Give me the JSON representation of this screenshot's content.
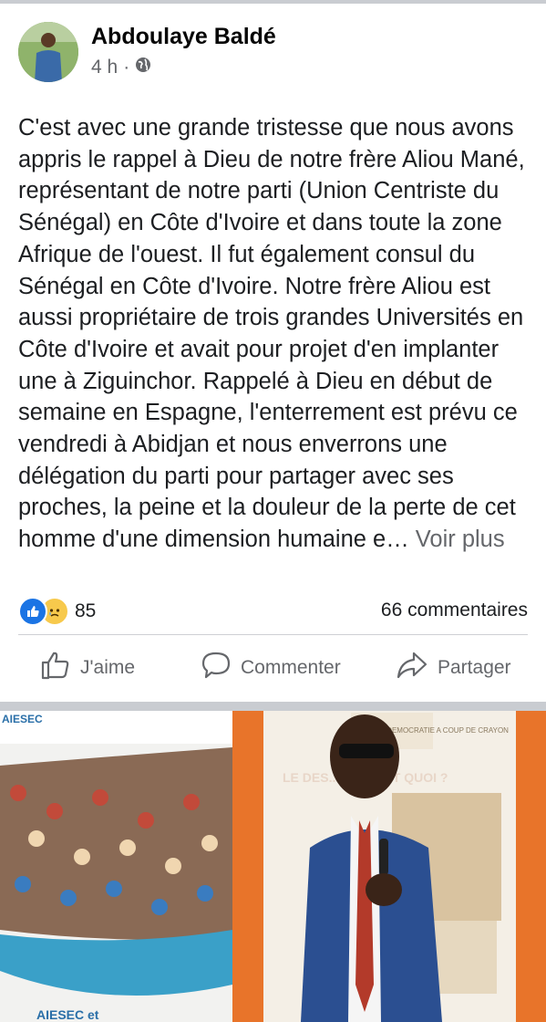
{
  "post": {
    "author": "Abdoulaye Baldé",
    "time": "4 h",
    "audience_icon": "globe-icon",
    "body": "C'est avec une grande tristesse que nous avons appris le rappel à Dieu de notre frère Aliou Mané, représentant de notre parti (Union Centriste du Sénégal) en Côte d'Ivoire et dans toute la zone Afrique de l'ouest. Il fut également consul du Sénégal en Côte d'Ivoire. Notre frère Aliou est aussi propriétaire de trois grandes Universités en Côte d'Ivoire et avait pour projet d'en implanter une à Ziguinchor. Rappelé à Dieu en début de semaine en Espagne, l'enterrement est prévu ce vendredi à Abidjan et nous enverrons une délégation du parti pour partager avec ses proches, la peine et la douleur de la perte de cet homme d'une dimension humaine e…",
    "see_more": "Voir plus",
    "reactions": {
      "icons": [
        "like-icon",
        "sad-icon"
      ],
      "count": "85",
      "comments": "66 commentaires"
    },
    "actions": {
      "like": "J'aime",
      "comment": "Commenter",
      "share": "Partager"
    }
  },
  "photo": {
    "banner_text": "LE DES... SE C'EST QUOI ?",
    "left_banner_top": "AIESEC",
    "left_banner_bottom": "AIESEC et",
    "poster_top": "PAIX ET DEMOCRATIE A COUP DE CRAYON"
  },
  "colors": {
    "brand_blue": "#1b74e4",
    "muted": "#65676b",
    "orange": "#e8742a"
  }
}
